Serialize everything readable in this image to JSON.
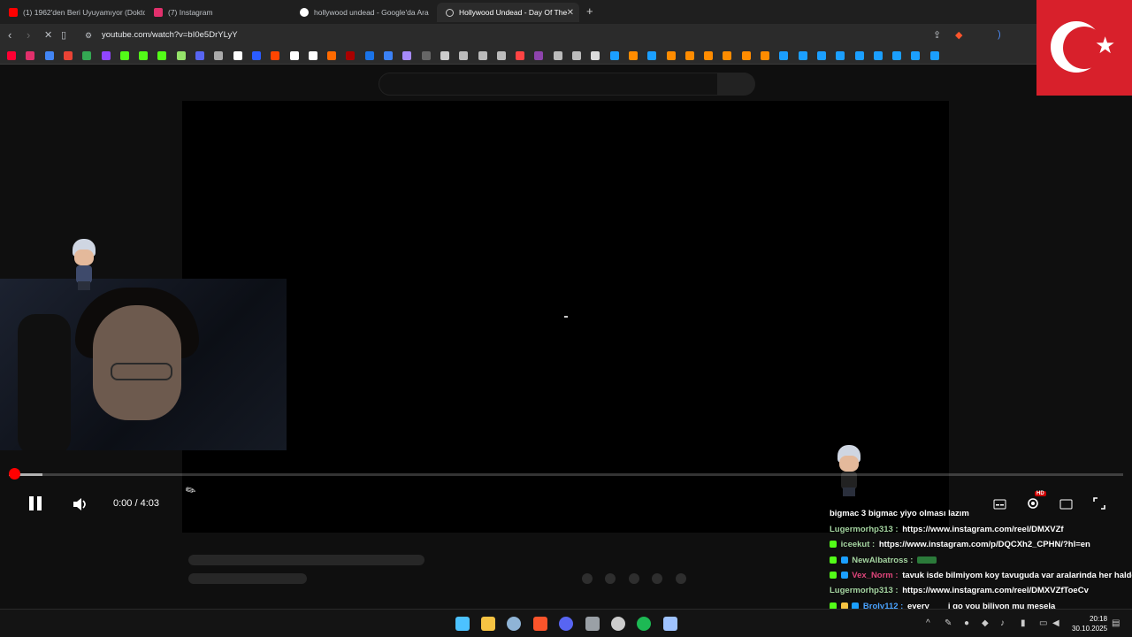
{
  "tabs": [
    {
      "title": "(1) 1962'den Beri Uyuyamıyor (Dokto",
      "favicon_color": "#ff0000"
    },
    {
      "title": "(7) Instagram",
      "favicon_color": "#e1306c"
    },
    {
      "title": "hollywood undead - Google'da Ara",
      "favicon_color": "#ffffff"
    },
    {
      "title": "Hollywood Undead - Day Of The",
      "favicon_color": "#ff0000",
      "active": true
    }
  ],
  "address_bar": {
    "url": "youtube.com/watch?v=bI0e5DrYLyY"
  },
  "bookmark_colors": [
    "#ff0033",
    "#e1306c",
    "#4285f4",
    "#ea4335",
    "#34a853",
    "#9146ff",
    "#53fc18",
    "#53fc18",
    "#53fc18",
    "#95e36a",
    "#5865f2",
    "#aaaaaa",
    "#ffffff",
    "#2b5cff",
    "#ff4500",
    "#ffffff",
    "#ffffff",
    "#ff6a00",
    "#aa0000",
    "#1a73e8",
    "#3b82f6",
    "#a78bfa",
    "#666666",
    "#cccccc",
    "#bbbbbb",
    "#bbbbbb",
    "#bbbbbb",
    "#ff4444",
    "#8e44ad",
    "#bbbbbb",
    "#bbbbbb",
    "#dddddd",
    "#1b9fff",
    "#ff8c00",
    "#1b9fff",
    "#ff8c00",
    "#ff8c00",
    "#ff8c00",
    "#ff8c00",
    "#ff8c00",
    "#ff8c00",
    "#1b9fff",
    "#1b9fff",
    "#1b9fff",
    "#1b9fff",
    "#1b9fff",
    "#1b9fff",
    "#1b9fff",
    "#1b9fff",
    "#1b9fff"
  ],
  "player": {
    "time_display": "0:00 / 4:03",
    "progress_fraction": 0.0,
    "quality_badge": "HD"
  },
  "chat": [
    {
      "user": "",
      "user_color": "#ffffff",
      "message": "bigmac 3 bigmac yiyo olması lazım"
    },
    {
      "user": "Lugermorhp313 :",
      "user_color": "#a4d4a0",
      "message": "https://www.instagram.com/reel/DMXVZf"
    },
    {
      "user": "iceekut :",
      "user_color": "#a4d4a0",
      "message": "https://www.instagram.com/p/DQCXh2_CPHN/?hl=en",
      "badge": "#53fc18"
    },
    {
      "user": "NewAlbatross :",
      "user_color": "#a4d4a0",
      "message": "",
      "badge": "#53fc18"
    },
    {
      "user": "Vex_Norm :",
      "user_color": "#e0457b",
      "message": "tavuk isde bilmiyom koy tavuguda var aralarinda her halde",
      "badge": "#53fc18"
    },
    {
      "user": "Lugermorhp313 :",
      "user_color": "#a4d4a0",
      "message": "https://www.instagram.com/reel/DMXVZfToeCv"
    },
    {
      "user": "Broly112 :",
      "user_color": "#4aa3ff",
      "message": "every        i go you biliyon mu mesela",
      "badge": "#53fc18"
    }
  ],
  "taskbar": {
    "icons": [
      {
        "name": "windows-start-icon",
        "color": "#4cc2ff"
      },
      {
        "name": "file-explorer-icon",
        "color": "#f6c343"
      },
      {
        "name": "steam-icon",
        "color": "#8fb4d6"
      },
      {
        "name": "brave-icon",
        "color": "#fb542b"
      },
      {
        "name": "discord-icon",
        "color": "#5865f2"
      },
      {
        "name": "app-icon",
        "color": "#9aa0a6"
      },
      {
        "name": "obs-icon",
        "color": "#cccccc"
      },
      {
        "name": "spotify-icon",
        "color": "#1db954"
      },
      {
        "name": "settings-icon",
        "color": "#9fc3ff"
      }
    ],
    "clock_time": "20:18",
    "clock_date": "30.10.2025"
  }
}
